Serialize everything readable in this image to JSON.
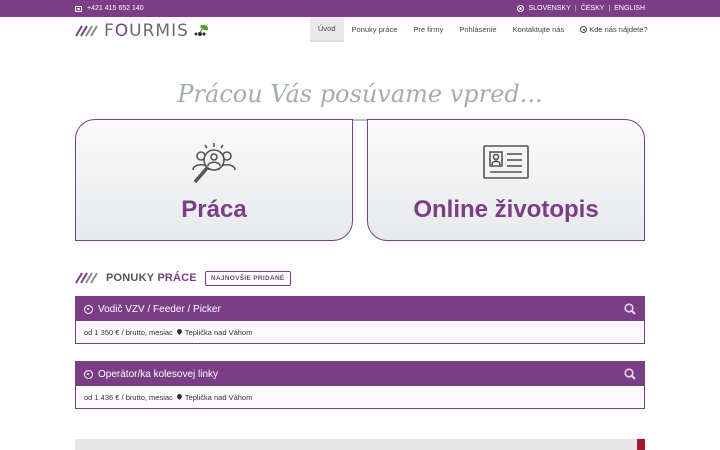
{
  "topbar": {
    "phone": "+421 415 652 140",
    "phone_icon": "phone-icon",
    "globe_icon": "globe-icon",
    "languages": [
      "SLOVENSKY",
      "ČESKY",
      "ENGLISH"
    ],
    "separator": "|"
  },
  "logo": {
    "prefix": "F",
    "highlight": "O",
    "rest": "URMIS"
  },
  "nav": {
    "items": [
      "Úvod",
      "Ponuky práce",
      "Pre firmy",
      "Prihlásenie",
      "Kontaktujte nás",
      "Kde nás nájdete?"
    ],
    "active_index": 0
  },
  "hero": {
    "title": "Prácou Vás posúvame vpred..."
  },
  "cards": {
    "work": {
      "label": "Práca",
      "icon": "search-people-icon"
    },
    "cv": {
      "label": "Online životopis",
      "icon": "id-card-icon"
    }
  },
  "section": {
    "title_part1": "PONUKY ",
    "title_part2": "PRÁCE",
    "badge": "NAJNOVŠIE PRIDANÉ"
  },
  "jobs": [
    {
      "title": "Vodič VZV / Feeder / Picker",
      "salary": "od 1 350 € / brutto, mesiac",
      "location": "Teplička nad Váhom"
    },
    {
      "title": "Operátor/ka kolesovej linky",
      "salary": "od 1 436 € / brutto, mesiac",
      "location": "Teplička nad Váhom"
    }
  ],
  "colors": {
    "brand": "#7b3d86",
    "hero_text": "#a4acb3",
    "accent_red": "#a3182f"
  }
}
